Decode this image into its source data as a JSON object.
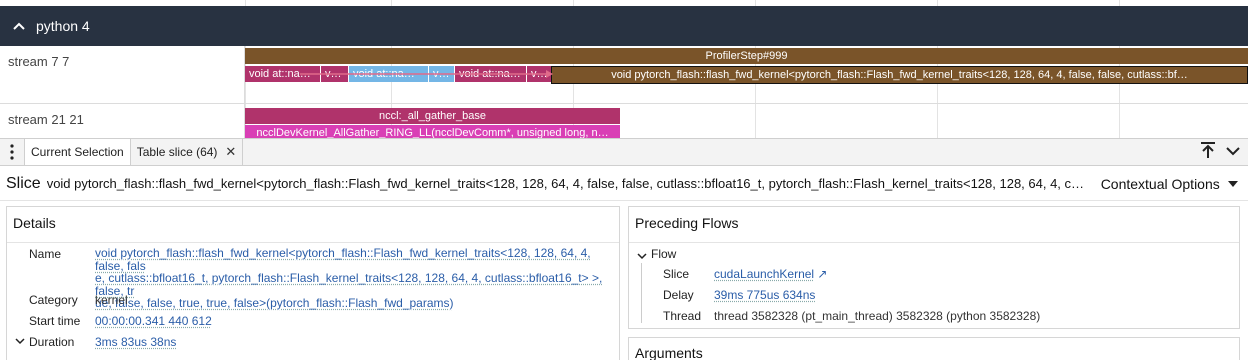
{
  "timeline": {
    "process_title": "python 4",
    "tracks": [
      {
        "label": "stream 7 7",
        "slices": [
          {
            "text": "ProfilerStep#999",
            "color": "#7a5429"
          },
          {
            "text": "void at::na…",
            "color": "#b0336b"
          },
          {
            "text": "vo…",
            "color": "#b0336b"
          },
          {
            "text": "void at::na…",
            "color": "#74b6e6"
          },
          {
            "text": "vo…",
            "color": "#74b6e6"
          },
          {
            "text": "void at::na…",
            "color": "#b0336b"
          },
          {
            "text": "v…",
            "color": "#b0336b"
          },
          {
            "text": "void pytorch_flash::flash_fwd_kernel<pytorch_flash::Flash_fwd_kernel_traits<128, 128, 64, 4, false, false, cutlass::bf…",
            "color": "#7a5429"
          }
        ]
      },
      {
        "label": "stream 21 21",
        "slices": [
          {
            "text": "nccl:_all_gather_base",
            "color": "#b0336b"
          },
          {
            "text": "ncclDevKernel_AllGather_RING_LL(ncclDevComm*, unsigned long, n…",
            "color": "#d93fb5"
          }
        ]
      }
    ]
  },
  "tabs": [
    {
      "label": "Current Selection"
    },
    {
      "label": "Table slice (64)"
    }
  ],
  "selection": {
    "kind": "Slice",
    "name": "void pytorch_flash::flash_fwd_kernel<pytorch_flash::Flash_fwd_kernel_traits<128, 128, 64, 4, false, false, cutlass::bfloat16_t, pytorch_flash::Flash_kernel_traits<128, 128, 64, 4, cutlass::bfloat16_t> >, false, true, false, false, true, true, false>(pytorch_flash::Flash_fwd_params)",
    "contextual_options": "Contextual Options"
  },
  "details": {
    "title": "Details",
    "name_label": "Name",
    "name_lines": [
      "void pytorch_flash::flash_fwd_kernel<pytorch_flash::Flash_fwd_kernel_traits<128, 128, 64, 4, false, fals",
      "e, cutlass::bfloat16_t, pytorch_flash::Flash_kernel_traits<128, 128, 64, 4, cutlass::bfloat16_t> >, false, tr",
      "ue, false, false, true, true, false>(pytorch_flash::Flash_fwd_params)"
    ],
    "category_label": "Category",
    "category": "kernel",
    "start_label": "Start time",
    "start": "00:00:00.341 440 612",
    "duration_label": "Duration",
    "duration": "3ms 83us 38ns"
  },
  "preceding": {
    "title": "Preceding Flows",
    "group": "Flow",
    "slice_label": "Slice",
    "slice": "cudaLaunchKernel",
    "delay_label": "Delay",
    "delay": "39ms 775us 634ns",
    "thread_label": "Thread",
    "thread": "thread 3582328 (pt_main_thread) 3582328 (python 3582328)"
  },
  "arguments": {
    "title": "Arguments"
  }
}
